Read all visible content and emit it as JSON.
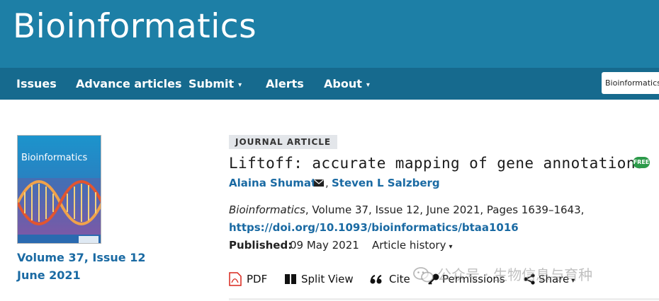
{
  "header": {
    "journal_title": "Bioinformatics"
  },
  "nav": {
    "items": [
      {
        "label": "Issues",
        "dropdown": false
      },
      {
        "label": "Advance articles",
        "dropdown": false
      },
      {
        "label": "Submit",
        "dropdown": true
      },
      {
        "label": "Alerts",
        "dropdown": false
      },
      {
        "label": "About",
        "dropdown": true
      }
    ],
    "search_scope_value": "Bioinformatics",
    "dropdown_caret": "▾"
  },
  "cover": {
    "title": "Bioinformatics",
    "volume_issue": "Volume 37, Issue 12",
    "date": "June 2021"
  },
  "article": {
    "type": "JOURNAL ARTICLE",
    "title": "Liftoff: accurate mapping of gene annotations",
    "free_badge": "FREE",
    "authors": [
      "Alaina Shumate",
      "Steven L Salzberg"
    ],
    "author_separator": ",",
    "journal": "Bioinformatics",
    "citation_rest": ", Volume 37, Issue 12, June 2021, Pages 1639–1643,",
    "doi": "https://doi.org/10.1093/bioinformatics/btaa1016",
    "published_label": "Published:",
    "published_date": "09 May 2021",
    "history_label": "Article history"
  },
  "toolbar": {
    "pdf": "PDF",
    "split_view": "Split View",
    "cite": "Cite",
    "permissions": "Permissions",
    "share": "Share"
  },
  "watermark": {
    "text": "公众号 · 生物信息与育种"
  },
  "colors": {
    "masthead": "#1d7fa6",
    "navbar": "#166a8e",
    "link": "#1a6aa3",
    "free_badge": "#2c9a4a",
    "pdf_icon": "#d9261c"
  }
}
